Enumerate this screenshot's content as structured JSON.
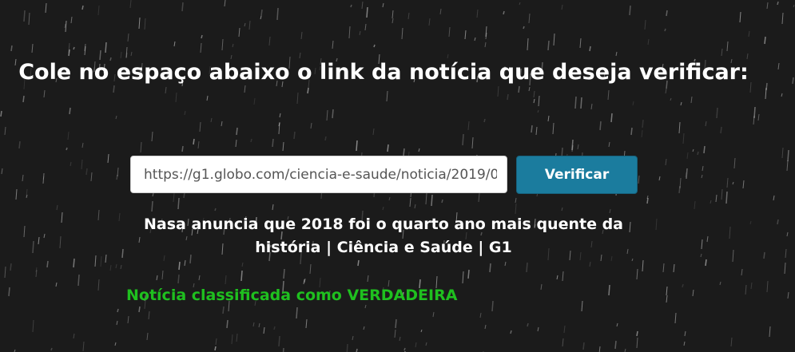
{
  "colors": {
    "background": "#1b1b1b",
    "button": "#1b7c9e",
    "result_true": "#1fc01f"
  },
  "page": {
    "heading": "Cole no espaço abaixo o link da notícia que deseja verificar:"
  },
  "form": {
    "url_value": "https://g1.globo.com/ciencia-e-saude/noticia/2019/0",
    "verify_label": "Verificar"
  },
  "result": {
    "news_title": "Nasa anuncia que 2018 foi o quarto ano mais quente da história | Ciência e Saúde | G1",
    "verdict": "Notícia classificada como VERDADEIRA"
  }
}
